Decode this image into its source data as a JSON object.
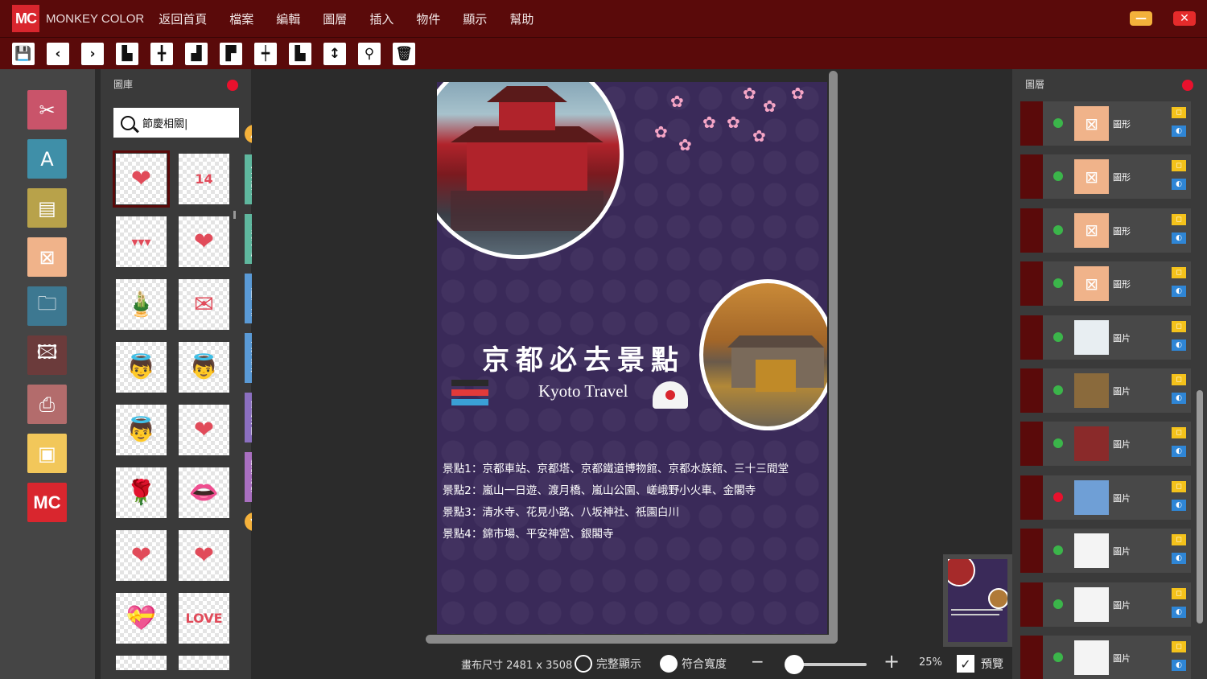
{
  "app": {
    "logo": "MC",
    "name": "MONKEY COLOR"
  },
  "menu": [
    "返回首頁",
    "檔案",
    "編輯",
    "圖層",
    "插入",
    "物件",
    "顯示",
    "幫助"
  ],
  "window": {
    "minimize": "—",
    "close": "✕"
  },
  "toolbar": [
    {
      "name": "save-icon",
      "glyph": "💾"
    },
    {
      "name": "undo-icon",
      "glyph": "‹"
    },
    {
      "name": "redo-icon",
      "glyph": "›"
    },
    {
      "name": "align-left-icon",
      "glyph": "▙"
    },
    {
      "name": "align-center-icon",
      "glyph": "╋"
    },
    {
      "name": "align-right-icon",
      "glyph": "▟"
    },
    {
      "name": "align-top-icon",
      "glyph": "▛"
    },
    {
      "name": "align-middle-icon",
      "glyph": "┿"
    },
    {
      "name": "align-bottom-icon",
      "glyph": "▙"
    },
    {
      "name": "flip-icon",
      "glyph": "↕"
    },
    {
      "name": "stamp-icon",
      "glyph": "⚲"
    },
    {
      "name": "trash-icon",
      "glyph": "🗑"
    }
  ],
  "tools": [
    {
      "name": "crop-tool-icon",
      "glyph": "✂",
      "color": "#c9546a"
    },
    {
      "name": "text-tool-icon",
      "glyph": "A",
      "color": "#3f8fa8"
    },
    {
      "name": "template-tool-icon",
      "glyph": "▤",
      "color": "#b8a24a"
    },
    {
      "name": "shape-tool-icon",
      "glyph": "⊠",
      "color": "#f0b38a"
    },
    {
      "name": "open-folder-icon",
      "glyph": "🗀",
      "color": "#3d7891"
    },
    {
      "name": "image-tool-icon",
      "glyph": "🖾",
      "color": "#6b3b3b"
    },
    {
      "name": "export-tool-icon",
      "glyph": "⎙",
      "color": "#b36c6c"
    },
    {
      "name": "background-tool-icon",
      "glyph": "▣",
      "color": "#f2c75a"
    },
    {
      "name": "mc-logo-icon",
      "glyph": "MC",
      "color": "#d9262e"
    }
  ],
  "gallery": {
    "title": "圖庫",
    "search_value": "節慶相關|",
    "items": [
      "❤",
      "14",
      "▾▾▾",
      "❤",
      "🎍",
      "✉",
      "👼",
      "👼",
      "👼",
      "❤",
      "🌹",
      "👄",
      "❤",
      "❤",
      "💝",
      "LOVE",
      "",
      ""
    ]
  },
  "categories": [
    {
      "label": "小城故事",
      "color": "#5fb79e"
    },
    {
      "label": "台灣專屬",
      "color": "#5fb79e"
    },
    {
      "label": "人間百業",
      "color": "#5a9ad6"
    },
    {
      "label": "文字藝術",
      "color": "#5a9ad6"
    },
    {
      "label": "節慶相關",
      "color": "#8b6fc0"
    },
    {
      "label": "動物植物",
      "color": "#a96fc0"
    }
  ],
  "poster": {
    "title_cn": "京都必去景點",
    "title_en": "Kyoto Travel",
    "spots": [
      "景點1：京都車站、京都塔、京都鐵道博物館、京都水族館、三十三間堂",
      "景點2：嵐山一日遊、渡月橋、嵐山公園、嵯峨野小火車、金閣寺",
      "景點3：清水寺、花見小路、八坂神社、祇園白川",
      "景點4：錦市場、平安神宮、銀閣寺"
    ]
  },
  "status": {
    "canvas_size": "畫布尺寸 2481 x 3508",
    "fit_all": "完整顯示",
    "fit_width": "符合寬度",
    "zoom_out": "−",
    "zoom_in": "+",
    "zoom": "25%",
    "preview": "預覽",
    "preview_checked": "✓",
    "zoom_fraction": 0.0
  },
  "layers_panel": {
    "title": "圖層",
    "layers": [
      {
        "name": "圖形",
        "thumb": "⊠",
        "status": "#3bb54a",
        "thumb_bg": "#f0b38a"
      },
      {
        "name": "圖形",
        "thumb": "⊠",
        "status": "#3bb54a",
        "thumb_bg": "#f0b38a"
      },
      {
        "name": "圖形",
        "thumb": "⊠",
        "status": "#3bb54a",
        "thumb_bg": "#f0b38a"
      },
      {
        "name": "圖形",
        "thumb": "⊠",
        "status": "#3bb54a",
        "thumb_bg": "#f0b38a"
      },
      {
        "name": "圖片",
        "thumb": "",
        "status": "#3bb54a",
        "thumb_bg": "#e8eef2"
      },
      {
        "name": "圖片",
        "thumb": "",
        "status": "#3bb54a",
        "thumb_bg": "#8a6a3c"
      },
      {
        "name": "圖片",
        "thumb": "",
        "status": "#3bb54a",
        "thumb_bg": "#8a2a2a"
      },
      {
        "name": "圖片",
        "thumb": "",
        "status": "#e8112d",
        "thumb_bg": "#6f9fd6"
      },
      {
        "name": "圖片",
        "thumb": "",
        "status": "#3bb54a",
        "thumb_bg": "#f4f4f4"
      },
      {
        "name": "圖片",
        "thumb": "",
        "status": "#3bb54a",
        "thumb_bg": "#f4f4f4"
      },
      {
        "name": "圖片",
        "thumb": "",
        "status": "#3bb54a",
        "thumb_bg": "#f4f4f4"
      }
    ]
  }
}
